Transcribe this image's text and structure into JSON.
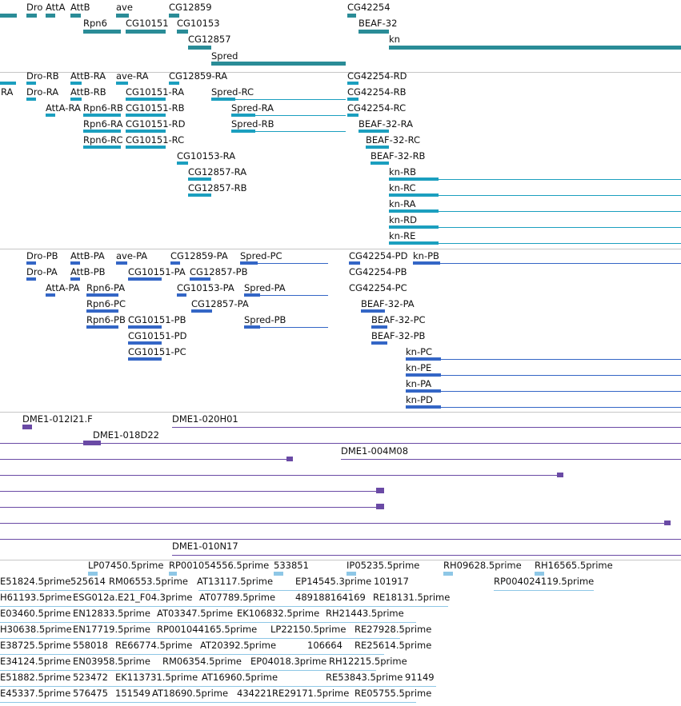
{
  "tracks": [
    {
      "name": "genes",
      "color": "#2a8c97",
      "labels": [
        "Dro",
        "AttA",
        "AttB",
        "ave",
        "CG12859",
        "CG42254",
        "Rpn6",
        "CG10151",
        "CG10153",
        "BEAF-32",
        "CG12857",
        "kn",
        "Spred"
      ]
    },
    {
      "name": "transcripts",
      "color": "#1b9fbf",
      "labels": [
        "Dro-RB",
        "AttB-RA",
        "ave-RA",
        "CG12859-RA",
        "CG42254-RD",
        "RA",
        "Dro-RA",
        "AttB-RB",
        "CG10151-RA",
        "Spred-RC",
        "CG42254-RB",
        "AttA-RA",
        "Rpn6-RB",
        "CG10151-RB",
        "Spred-RA",
        "CG42254-RC",
        "Rpn6-RA",
        "CG10151-RD",
        "Spred-RB",
        "BEAF-32-RA",
        "Rpn6-RC",
        "CG10151-RC",
        "BEAF-32-RC",
        "CG10153-RA",
        "BEAF-32-RB",
        "CG12857-RA",
        "kn-RB",
        "CG12857-RB",
        "kn-RC",
        "kn-RA",
        "kn-RD",
        "kn-RE"
      ]
    },
    {
      "name": "proteins",
      "color": "#3466c6",
      "labels": [
        "Dro-PB",
        "AttB-PA",
        "ave-PA",
        "CG12859-PA",
        "Spred-PC",
        "CG42254-PD",
        "kn-PB",
        "Dro-PA",
        "AttB-PB",
        "CG10151-PA",
        "CG12857-PB",
        "CG42254-PB",
        "AttA-PA",
        "Rpn6-PA",
        "CG10153-PA",
        "Spred-PA",
        "CG42254-PC",
        "Rpn6-PC",
        "CG12857-PA",
        "BEAF-32-PA",
        "Rpn6-PB",
        "CG10151-PB",
        "Spred-PB",
        "BEAF-32-PC",
        "CG10151-PD",
        "BEAF-32-PB",
        "CG10151-PC",
        "kn-PC",
        "kn-PE",
        "kn-PA",
        "kn-PD"
      ]
    },
    {
      "name": "bac-clones",
      "color": "#6a4aa5",
      "labels": [
        "DME1-012I21.F",
        "DME1-020H01",
        "DME1-018D22",
        "DME1-004M08",
        "DME1-010N17"
      ]
    },
    {
      "name": "est",
      "color": "#8ec7e6",
      "labels": [
        "LP07450.5prime",
        "RP001054556.5prime",
        "533851",
        "IP05235.5prime",
        "RH09628.5prime",
        "RH16565.5prime",
        "E51824.5prime",
        "525614",
        "RM06553.5prime",
        "AT13117.5prime",
        "EP14545.3prime",
        "101917",
        "RP004024119.5prime",
        "H61193.5prime",
        "ESG012a.E21_F04.3prime",
        "AT07789.5prime",
        "489188164169",
        "RE18131.5prime",
        "E03460.5prime",
        "EN12833.5prime",
        "AT03347.5prime",
        "EK106832.5prime",
        "RH21443.5prime",
        "H30638.5prime",
        "EN17719.5prime",
        "RP001044165.5prime",
        "LP22150.5prime",
        "RE27928.5prime",
        "E38725.5prime",
        "558018",
        "RE66774.5prime",
        "AT20392.5prime",
        "106664",
        "RE25614.5prime",
        "E34124.5prime",
        "EN03958.5prime",
        "RM06354.5prime",
        "EP04018.3prime",
        "RH12215.5prime",
        "E51882.5prime",
        "523472",
        "EK113731.5prime",
        "AT16960.5prime",
        "RE53843.5prime",
        "91149",
        "E45337.5prime",
        "576475",
        "151549",
        "AT18690.5prime",
        "434221",
        "RE29171.5prime",
        "RE05755.5prime"
      ]
    }
  ]
}
